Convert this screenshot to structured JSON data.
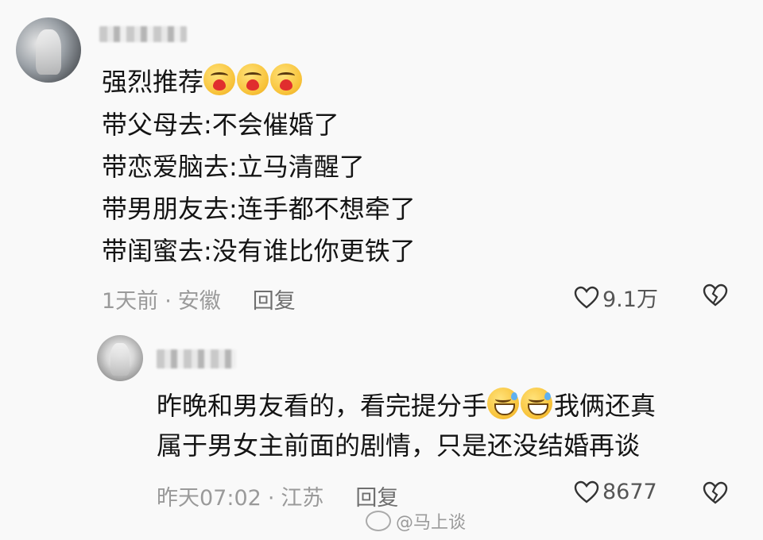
{
  "comment_main": {
    "lines": [
      "强烈推荐",
      "带父母去:不会催婚了",
      "带恋爱脑去:立马清醒了",
      "带男朋友去:连手都不想牵了",
      "带闺蜜去:没有谁比你更铁了"
    ],
    "emojis": [
      "heart-face-emoji",
      "heart-face-emoji",
      "heart-face-emoji"
    ],
    "time": "1天前",
    "location": "安徽",
    "reply_label": "回复",
    "likes": "9.1万"
  },
  "comment_reply": {
    "line1_a": "昨晚和男友看的，看完提分手",
    "line1_b": "我俩还真",
    "line2": "属于男女主前面的剧情，只是还没结婚再谈",
    "emojis": [
      "laughing-sweat-emoji",
      "laughing-sweat-emoji"
    ],
    "time": "昨天07:02",
    "location": "江苏",
    "reply_label": "回复",
    "likes": "8677"
  },
  "watermark": "@马上谈",
  "separator": "·",
  "colors": {
    "text": "#141414",
    "meta": "#9a9a9a",
    "background": "#f9f9f9"
  }
}
